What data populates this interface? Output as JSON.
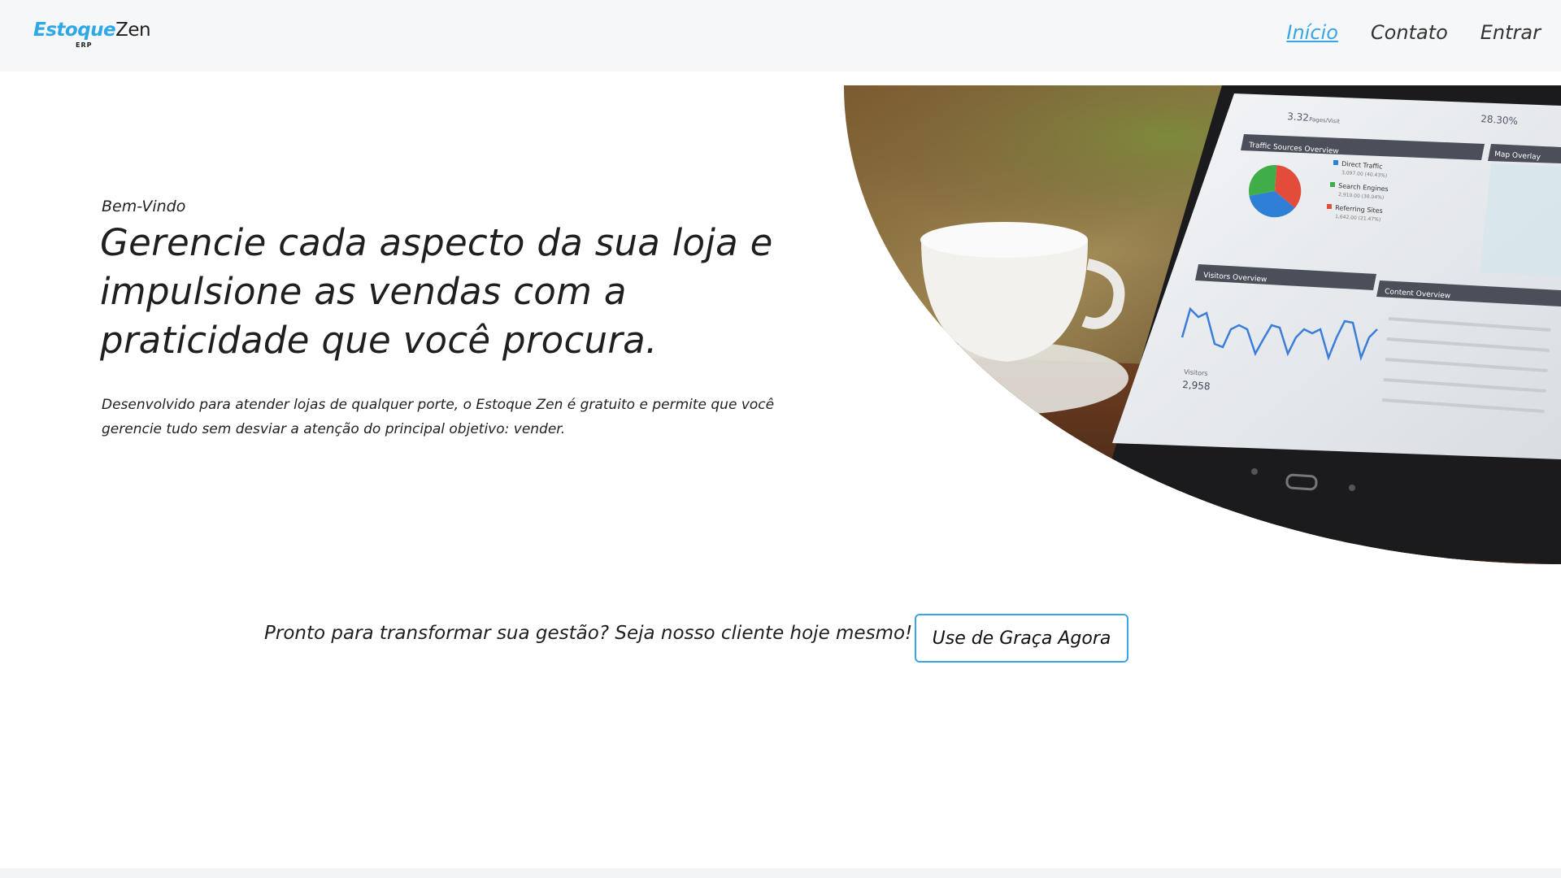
{
  "header": {
    "logo": {
      "brand": "Estoque",
      "rest": "Zen",
      "sub": "ERP"
    },
    "nav": [
      {
        "label": "Início",
        "active": true
      },
      {
        "label": "Contato",
        "active": false
      },
      {
        "label": "Entrar",
        "active": false
      }
    ]
  },
  "hero": {
    "welcome": "Bem-Vindo",
    "headline": "Gerencie cada aspecto da sua loja e impulsione as vendas com a praticidade que você procura.",
    "description": "Desenvolvido para atender lojas de qualquer porte, o Estoque Zen é gratuito e permite que você gerencie tudo sem desviar a atenção do principal objetivo: vender.",
    "image": {
      "top_value": "3.32",
      "top_value_label": "Pages/Visit",
      "top_right_value": "28.30%",
      "panel_traffic_title": "Traffic Sources Overview",
      "panel_map_title": "Map Overlay",
      "panel_visitors_title": "Visitors Overview",
      "panel_content_title": "Content Overview",
      "legend": [
        {
          "label": "Direct Traffic",
          "detail": "3,097.00 (40.43%)",
          "color": "#2f7fd6"
        },
        {
          "label": "Search Engines",
          "detail": "2,910.00 (38.04%)",
          "color": "#3fae49"
        },
        {
          "label": "Referring Sites",
          "detail": "1,642.00 (21.47%)",
          "color": "#e34b3b"
        }
      ],
      "visitors_label": "Visitors",
      "visitors_value": "2,958"
    }
  },
  "cta": {
    "text": "Pronto para transformar sua gestão? Seja nosso cliente hoje mesmo!",
    "button_label": "Use de Graça Agora"
  },
  "colors": {
    "accent": "#3aa5e6",
    "header_bg": "#f6f7f8",
    "text": "#1f1f1f"
  }
}
